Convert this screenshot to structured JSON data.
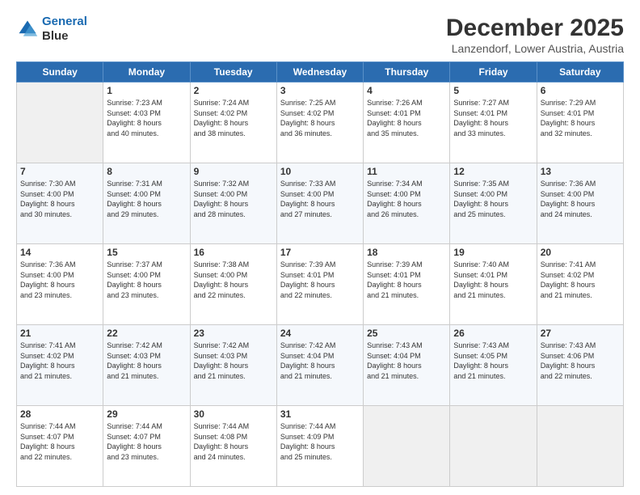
{
  "logo": {
    "line1": "General",
    "line2": "Blue"
  },
  "header": {
    "month": "December 2025",
    "location": "Lanzendorf, Lower Austria, Austria"
  },
  "days": [
    "Sunday",
    "Monday",
    "Tuesday",
    "Wednesday",
    "Thursday",
    "Friday",
    "Saturday"
  ],
  "weeks": [
    [
      {
        "day": "",
        "empty": true
      },
      {
        "day": "1",
        "sunrise": "7:23 AM",
        "sunset": "4:03 PM",
        "daylight": "8 hours and 40 minutes."
      },
      {
        "day": "2",
        "sunrise": "7:24 AM",
        "sunset": "4:02 PM",
        "daylight": "8 hours and 38 minutes."
      },
      {
        "day": "3",
        "sunrise": "7:25 AM",
        "sunset": "4:02 PM",
        "daylight": "8 hours and 36 minutes."
      },
      {
        "day": "4",
        "sunrise": "7:26 AM",
        "sunset": "4:01 PM",
        "daylight": "8 hours and 35 minutes."
      },
      {
        "day": "5",
        "sunrise": "7:27 AM",
        "sunset": "4:01 PM",
        "daylight": "8 hours and 33 minutes."
      },
      {
        "day": "6",
        "sunrise": "7:29 AM",
        "sunset": "4:01 PM",
        "daylight": "8 hours and 32 minutes."
      }
    ],
    [
      {
        "day": "7",
        "sunrise": "7:30 AM",
        "sunset": "4:00 PM",
        "daylight": "8 hours and 30 minutes."
      },
      {
        "day": "8",
        "sunrise": "7:31 AM",
        "sunset": "4:00 PM",
        "daylight": "8 hours and 29 minutes."
      },
      {
        "day": "9",
        "sunrise": "7:32 AM",
        "sunset": "4:00 PM",
        "daylight": "8 hours and 28 minutes."
      },
      {
        "day": "10",
        "sunrise": "7:33 AM",
        "sunset": "4:00 PM",
        "daylight": "8 hours and 27 minutes."
      },
      {
        "day": "11",
        "sunrise": "7:34 AM",
        "sunset": "4:00 PM",
        "daylight": "8 hours and 26 minutes."
      },
      {
        "day": "12",
        "sunrise": "7:35 AM",
        "sunset": "4:00 PM",
        "daylight": "8 hours and 25 minutes."
      },
      {
        "day": "13",
        "sunrise": "7:36 AM",
        "sunset": "4:00 PM",
        "daylight": "8 hours and 24 minutes."
      }
    ],
    [
      {
        "day": "14",
        "sunrise": "7:36 AM",
        "sunset": "4:00 PM",
        "daylight": "8 hours and 23 minutes."
      },
      {
        "day": "15",
        "sunrise": "7:37 AM",
        "sunset": "4:00 PM",
        "daylight": "8 hours and 23 minutes."
      },
      {
        "day": "16",
        "sunrise": "7:38 AM",
        "sunset": "4:00 PM",
        "daylight": "8 hours and 22 minutes."
      },
      {
        "day": "17",
        "sunrise": "7:39 AM",
        "sunset": "4:01 PM",
        "daylight": "8 hours and 22 minutes."
      },
      {
        "day": "18",
        "sunrise": "7:39 AM",
        "sunset": "4:01 PM",
        "daylight": "8 hours and 21 minutes."
      },
      {
        "day": "19",
        "sunrise": "7:40 AM",
        "sunset": "4:01 PM",
        "daylight": "8 hours and 21 minutes."
      },
      {
        "day": "20",
        "sunrise": "7:41 AM",
        "sunset": "4:02 PM",
        "daylight": "8 hours and 21 minutes."
      }
    ],
    [
      {
        "day": "21",
        "sunrise": "7:41 AM",
        "sunset": "4:02 PM",
        "daylight": "8 hours and 21 minutes."
      },
      {
        "day": "22",
        "sunrise": "7:42 AM",
        "sunset": "4:03 PM",
        "daylight": "8 hours and 21 minutes."
      },
      {
        "day": "23",
        "sunrise": "7:42 AM",
        "sunset": "4:03 PM",
        "daylight": "8 hours and 21 minutes."
      },
      {
        "day": "24",
        "sunrise": "7:42 AM",
        "sunset": "4:04 PM",
        "daylight": "8 hours and 21 minutes."
      },
      {
        "day": "25",
        "sunrise": "7:43 AM",
        "sunset": "4:04 PM",
        "daylight": "8 hours and 21 minutes."
      },
      {
        "day": "26",
        "sunrise": "7:43 AM",
        "sunset": "4:05 PM",
        "daylight": "8 hours and 21 minutes."
      },
      {
        "day": "27",
        "sunrise": "7:43 AM",
        "sunset": "4:06 PM",
        "daylight": "8 hours and 22 minutes."
      }
    ],
    [
      {
        "day": "28",
        "sunrise": "7:44 AM",
        "sunset": "4:07 PM",
        "daylight": "8 hours and 22 minutes."
      },
      {
        "day": "29",
        "sunrise": "7:44 AM",
        "sunset": "4:07 PM",
        "daylight": "8 hours and 23 minutes."
      },
      {
        "day": "30",
        "sunrise": "7:44 AM",
        "sunset": "4:08 PM",
        "daylight": "8 hours and 24 minutes."
      },
      {
        "day": "31",
        "sunrise": "7:44 AM",
        "sunset": "4:09 PM",
        "daylight": "8 hours and 25 minutes."
      },
      {
        "day": "",
        "empty": true
      },
      {
        "day": "",
        "empty": true
      },
      {
        "day": "",
        "empty": true
      }
    ]
  ],
  "labels": {
    "sunrise": "Sunrise:",
    "sunset": "Sunset:",
    "daylight": "Daylight:"
  }
}
